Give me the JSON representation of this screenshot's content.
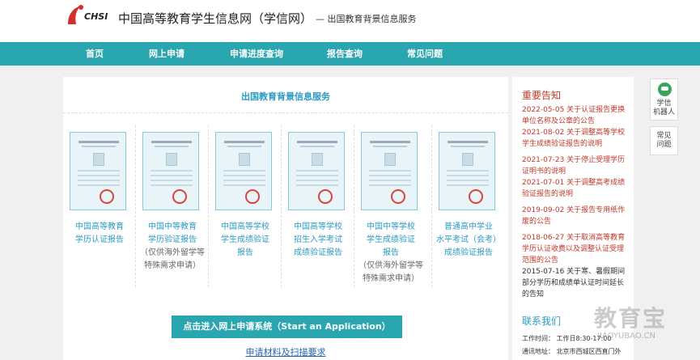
{
  "header": {
    "logo_text": "CHSI",
    "site_title": "中国高等教育学生信息网（学信网）",
    "sub_title": "— 出国教育背景信息服务"
  },
  "nav": [
    {
      "label": "首页"
    },
    {
      "label": "网上申请"
    },
    {
      "label": "申请进度查询"
    },
    {
      "label": "报告查询"
    },
    {
      "label": "常见问题"
    }
  ],
  "main": {
    "title": "出国教育背景信息服务",
    "certs": [
      {
        "lines": [
          "中国高等教育",
          "学历认证报告"
        ],
        "note": []
      },
      {
        "lines": [
          "中国中等教育",
          "学历验证报告"
        ],
        "note": [
          "（仅供海外留学等",
          "特殊需求申请）"
        ]
      },
      {
        "lines": [
          "中国高等学校",
          "学生成绩验证",
          "报告"
        ],
        "note": []
      },
      {
        "lines": [
          "中国高等学校",
          "招生入学考试",
          "成绩验证报告"
        ],
        "note": []
      },
      {
        "lines": [
          "中国中等学校",
          "学生成绩验证",
          "报告"
        ],
        "note": [
          "（仅供海外留学等",
          "特殊需求申请）"
        ]
      },
      {
        "lines": [
          "普通高中学业",
          "水平考试（会考）",
          "成绩验证报告"
        ],
        "note": []
      }
    ],
    "apply_button": "点击进入网上申请系统（Start an Application）",
    "materials_link": "申请材料及扫描要求"
  },
  "sidebar": {
    "notices_heading": "重要告知",
    "notices": [
      {
        "text": "2022-05-05 关于认证报告更换单位名称及公章的公告",
        "color": "red"
      },
      {
        "text": "2021-08-02 关于调整高等学校学生成绩验证报告的说明",
        "color": "red"
      },
      {
        "text": "2021-07-23 关于停止受理学历证明书的说明",
        "color": "red"
      },
      {
        "text": "2021-07-01 关于调整高考成绩验证报告的说明",
        "color": "red"
      },
      {
        "text": "2019-09-02 关于报告专用纸作废的公告",
        "color": "red"
      },
      {
        "text": "2018-06-27 关于取消高等教育学历认证收费以及调整认证受理范围的公告",
        "color": "red"
      },
      {
        "text": "2015-07-16 关于寒、暑假期间部分学历和成绩单认证时间延长的告知",
        "color": "dark"
      }
    ],
    "contact_heading": "联系我们",
    "contact_lines": [
      "工作时间：  工作日8:30-17:00",
      "通讯地址：  北京市西城区西直门外"
    ]
  },
  "floating": {
    "robot_label": [
      "学信",
      "机器人"
    ],
    "faq_label": [
      "常见",
      "问题"
    ]
  },
  "watermark": {
    "text": "教育宝",
    "sub": "JIAOYUBAO.CN"
  }
}
